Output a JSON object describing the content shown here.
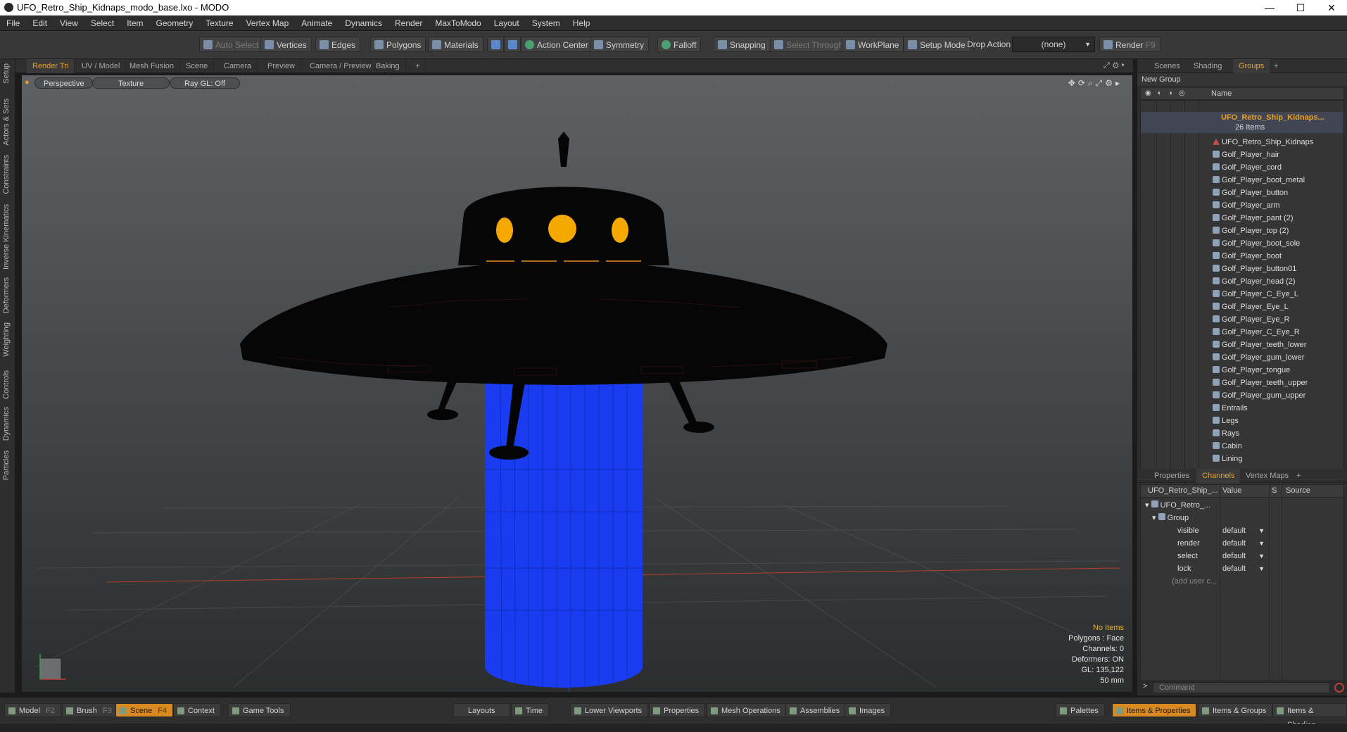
{
  "window": {
    "title": "UFO_Retro_Ship_Kidnaps_modo_base.lxo - MODO",
    "minimize": "—",
    "maximize": "☐",
    "close": "✕"
  },
  "menu": [
    "File",
    "Edit",
    "View",
    "Select",
    "Item",
    "Geometry",
    "Texture",
    "Vertex Map",
    "Animate",
    "Dynamics",
    "Render",
    "MaxToModo",
    "Layout",
    "System",
    "Help"
  ],
  "toolbar": {
    "auto_select": "Auto Select",
    "vertices": "Vertices",
    "edges": "Edges",
    "polygons": "Polygons",
    "materials": "Materials",
    "action_center": "Action Center",
    "symmetry": "Symmetry",
    "falloff": "Falloff",
    "snapping": "Snapping",
    "select_through": "Select Through",
    "workplane": "WorkPlane",
    "setup_mode": "Setup Mode",
    "drop_action": "Drop Action",
    "drop_value": "(none)",
    "render": "Render",
    "render_key": "F9"
  },
  "left_tabs": [
    "Setup",
    "Actors & Sets",
    "Constraints",
    "Inverse Kinematics",
    "Deformers",
    "Weighting",
    "Controls",
    "Dynamics",
    "Particles"
  ],
  "viewport_tabs": [
    "Render Tri",
    "UV / Model",
    "Mesh Fusion",
    "Scene",
    "Camera",
    "Preview",
    "Camera / Preview",
    "Baking",
    "+"
  ],
  "viewport": {
    "perspective": "Perspective",
    "texture": "Texture",
    "raygl": "Ray GL: Off",
    "info": {
      "items": "No Items",
      "polygons": "Polygons : Face",
      "channels": "Channels: 0",
      "deformers": "Deformers: ON",
      "gl": "GL: 135,122",
      "lens": "50 mm"
    }
  },
  "right_tabs": [
    "Scenes",
    "Shading",
    "Groups",
    "+"
  ],
  "groups": {
    "new_group": "New Group",
    "name_header": "Name",
    "root_name": "UFO_Retro_Ship_Kidnaps...",
    "root_count": "26 Items",
    "items": [
      "UFO_Retro_Ship_Kidnaps",
      "Golf_Player_hair",
      "Golf_Player_cord",
      "Golf_Player_boot_metal",
      "Golf_Player_button",
      "Golf_Player_arm",
      "Golf_Player_pant (2)",
      "Golf_Player_top (2)",
      "Golf_Player_boot_sole",
      "Golf_Player_boot",
      "Golf_Player_button01",
      "Golf_Player_head (2)",
      "Golf_Player_C_Eye_L",
      "Golf_Player_Eye_L",
      "Golf_Player_Eye_R",
      "Golf_Player_C_Eye_R",
      "Golf_Player_teeth_lower",
      "Golf_Player_gum_lower",
      "Golf_Player_tongue",
      "Golf_Player_teeth_upper",
      "Golf_Player_gum_upper",
      "Entrails",
      "Legs",
      "Rays",
      "Cabin",
      "Lining"
    ]
  },
  "prop_tabs": [
    "Properties",
    "Channels",
    "Vertex Maps",
    "+"
  ],
  "channels": {
    "col_name": "UFO_Retro_Ship_...",
    "col_value": "Value",
    "col_s": "S",
    "col_source": "Source",
    "root": "UFO_Retro_...",
    "group": "Group",
    "rows": [
      {
        "name": "visible",
        "value": "default"
      },
      {
        "name": "render",
        "value": "default"
      },
      {
        "name": "select",
        "value": "default"
      },
      {
        "name": "lock",
        "value": "default"
      }
    ],
    "add_user": "(add user c..."
  },
  "command": {
    "prompt": ">",
    "placeholder": "Command"
  },
  "bottom": {
    "model": "Model",
    "model_key": "F2",
    "brush": "Brush",
    "brush_key": "F3",
    "scene": "Scene",
    "scene_key": "F4",
    "context": "Context",
    "game_tools": "Game Tools",
    "layouts": "Layouts",
    "time": "Time",
    "lower_viewports": "Lower Viewports",
    "properties": "Properties",
    "mesh_operations": "Mesh Operations",
    "assemblies": "Assemblies",
    "images": "Images",
    "palettes": "Palettes",
    "items_properties": "Items & Properties",
    "items_groups": "Items & Groups",
    "items_shading": "Items & Shading"
  },
  "colors": {
    "accent": "#f0a020",
    "beam": "#1a3cf0",
    "window_glow": "#f5a800"
  }
}
